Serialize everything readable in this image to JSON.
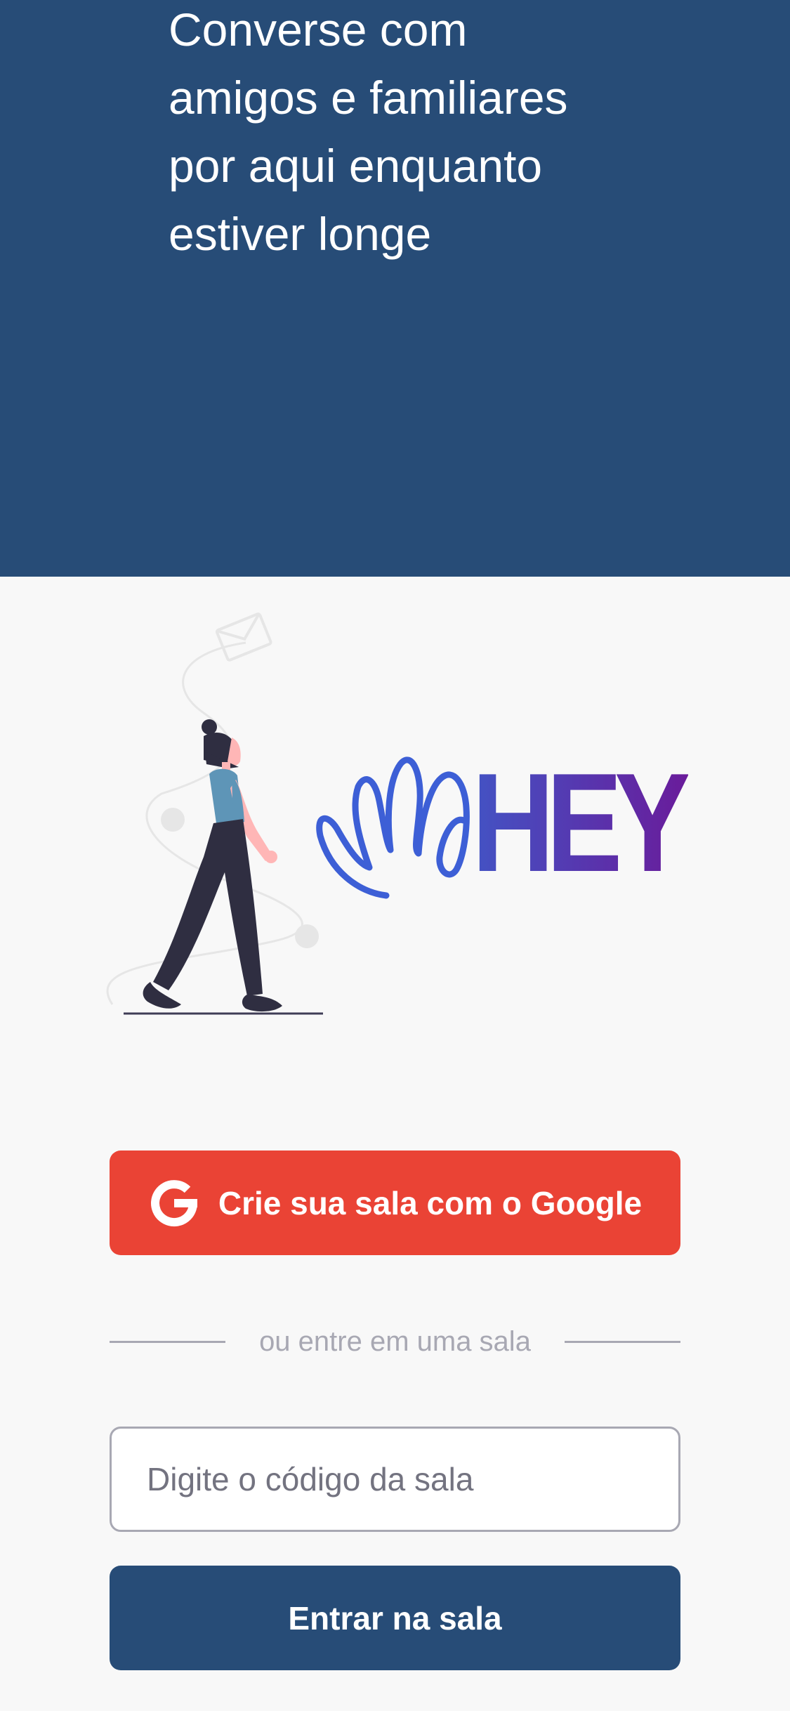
{
  "hero": {
    "text": "Converse com\namigos e familiares\npor aqui enquanto\nestiver longe",
    "background_color": "#274c77"
  },
  "illustration": {
    "icon": "woman-walking-illustration"
  },
  "logo": {
    "text": "HEY",
    "icon": "waving-hand-icon",
    "gradient": [
      "#4353c4",
      "#6a1b9a"
    ]
  },
  "google_button": {
    "label": "Crie sua sala com o Google",
    "icon": "google-icon",
    "color": "#ea4335"
  },
  "divider": {
    "label": "ou entre em uma sala"
  },
  "room_input": {
    "placeholder": "Digite o código da sala",
    "value": ""
  },
  "enter_button": {
    "label": "Entrar na sala",
    "color": "#274c77"
  }
}
